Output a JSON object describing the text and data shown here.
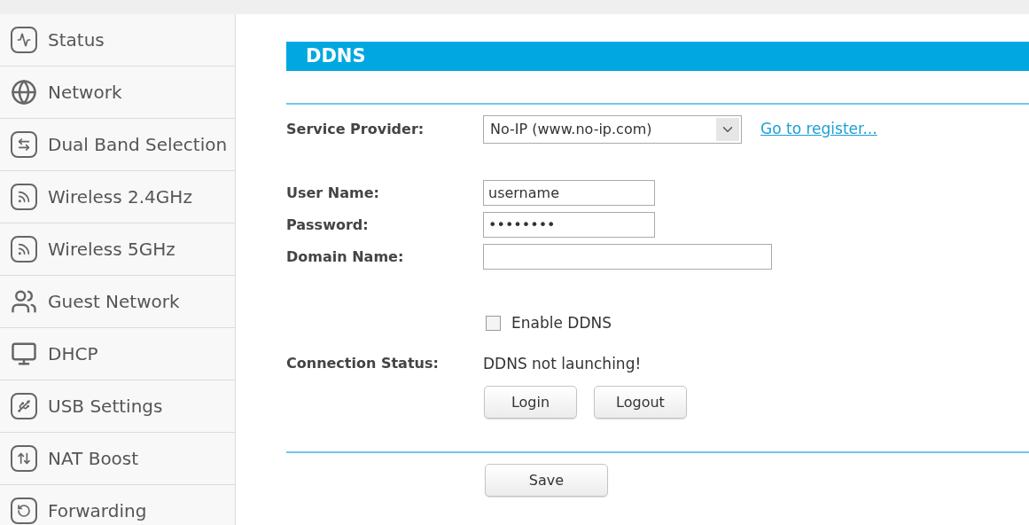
{
  "sidebar": {
    "items": [
      {
        "label": "Status",
        "selected": false
      },
      {
        "label": "Network",
        "selected": false
      },
      {
        "label": "Dual Band Selection",
        "selected": false
      },
      {
        "label": "Wireless 2.4GHz",
        "selected": false
      },
      {
        "label": "Wireless 5GHz",
        "selected": false
      },
      {
        "label": "Guest Network",
        "selected": false
      },
      {
        "label": "DHCP",
        "selected": false
      },
      {
        "label": "USB Settings",
        "selected": false
      },
      {
        "label": "NAT Boost",
        "selected": false
      },
      {
        "label": "Forwarding",
        "selected": false
      }
    ]
  },
  "panel": {
    "title": "DDNS",
    "service_provider": {
      "label": "Service Provider:",
      "value": "No-IP (www.no-ip.com)",
      "link": "Go to register..."
    },
    "user_name": {
      "label": "User Name:",
      "value": "username"
    },
    "password": {
      "label": "Password:",
      "value": "••••••••"
    },
    "domain_name": {
      "label": "Domain Name:"
    },
    "enable_ddns": {
      "label": "Enable DDNS",
      "checked": false
    },
    "connection_status": {
      "label": "Connection Status:",
      "value": "DDNS not launching!"
    },
    "actions": [
      "Login",
      "Logout"
    ],
    "save": "Save"
  }
}
